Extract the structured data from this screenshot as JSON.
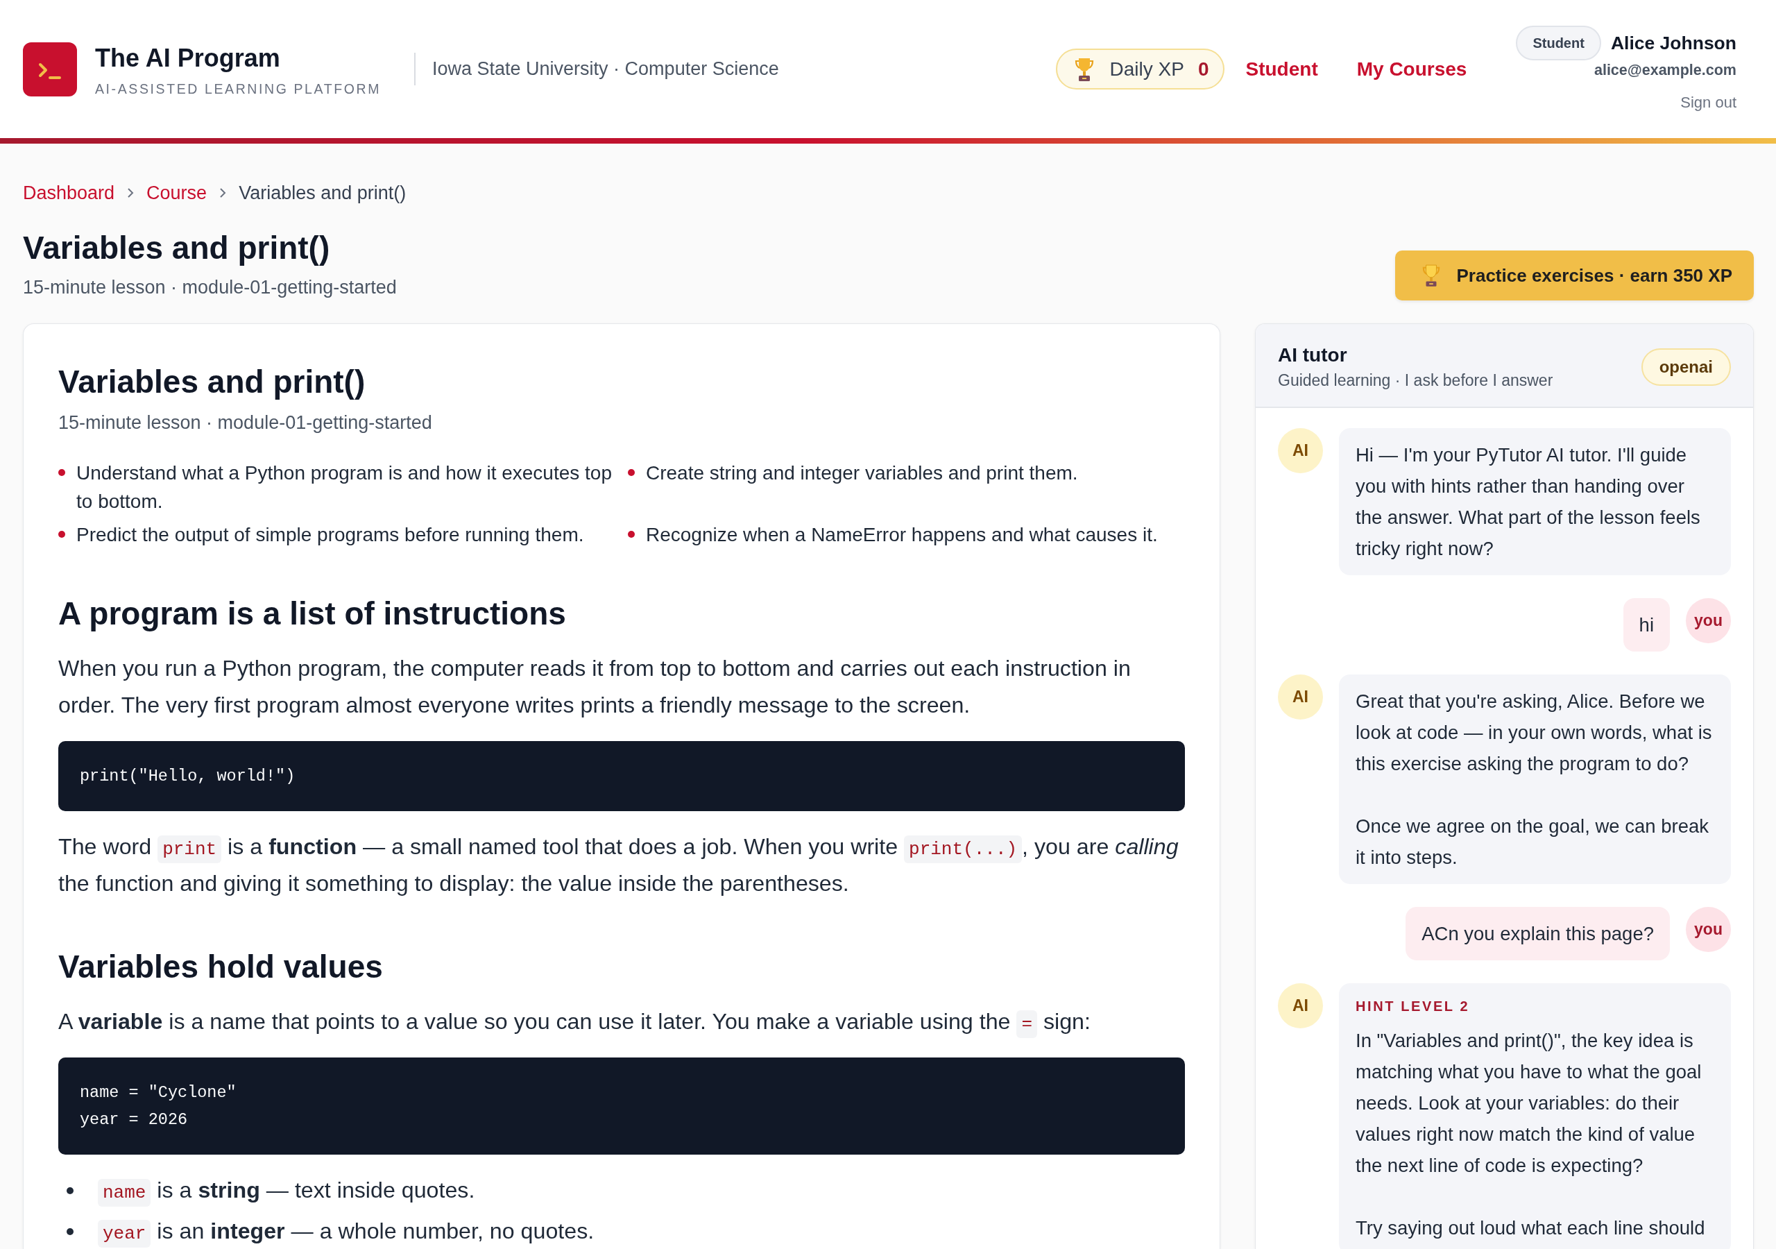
{
  "header": {
    "brand": {
      "title": "The AI Program",
      "tagline": "AI-ASSISTED LEARNING PLATFORM"
    },
    "institution": "Iowa State University · Computer Science",
    "daily_xp": {
      "label": "Daily XP",
      "value": "0"
    },
    "nav": [
      {
        "label": "Student"
      },
      {
        "label": "My Courses"
      }
    ],
    "user": {
      "role": "Student",
      "name": "Alice Johnson",
      "email": "alice@example.com",
      "sign_out": "Sign out"
    }
  },
  "breadcrumb": [
    {
      "label": "Dashboard",
      "kind": "link"
    },
    {
      "label": "Course",
      "kind": "link"
    },
    {
      "label": "Variables and print()",
      "kind": "current"
    }
  ],
  "page_header": {
    "title": "Variables and print()",
    "meta": "15-minute lesson · module-01-getting-started",
    "practice_button": "Practice exercises · earn 350 XP"
  },
  "lesson": {
    "title": "Variables and print()",
    "meta": "15-minute lesson · module-01-getting-started",
    "objectives": [
      "Understand what a Python program is and how it executes top to bottom.",
      "Create string and integer variables and print them.",
      "Predict the output of simple programs before running them.",
      "Recognize when a NameError happens and what causes it."
    ],
    "blocks": [
      {
        "kind": "heading",
        "text": "A program is a list of instructions"
      },
      {
        "kind": "paragraph",
        "parts": [
          {
            "kind": "text",
            "text": "When you run a Python program, the computer reads it from top to bottom and carries out each instruction in order. The very first program almost everyone writes prints a friendly message to the screen."
          }
        ]
      },
      {
        "kind": "code",
        "lines": [
          "print(\"Hello, world!\")"
        ]
      },
      {
        "kind": "paragraph",
        "parts": [
          {
            "kind": "text",
            "text": "The word "
          },
          {
            "kind": "code",
            "text": "print"
          },
          {
            "kind": "text",
            "text": " is a **function** — a small named tool that does a job. When you write "
          },
          {
            "kind": "code",
            "text": "print(...)"
          },
          {
            "kind": "text",
            "text": ", you are *calling* the function and giving it something to display: the value inside the parentheses."
          }
        ]
      },
      {
        "kind": "heading",
        "text": "Variables hold values"
      },
      {
        "kind": "paragraph",
        "parts": [
          {
            "kind": "text",
            "text": "A **variable** is a name that points to a value so you can use it later. You make a variable using the "
          },
          {
            "kind": "code",
            "text": "="
          },
          {
            "kind": "text",
            "text": " sign:"
          }
        ]
      },
      {
        "kind": "code",
        "lines": [
          "name = \"Cyclone\"",
          "year = 2026"
        ]
      },
      {
        "kind": "list",
        "items": [
          {
            "parts": [
              {
                "kind": "code",
                "text": "name"
              },
              {
                "kind": "text",
                "text": " is a **string** — text inside quotes."
              }
            ]
          },
          {
            "parts": [
              {
                "kind": "code",
                "text": "year"
              },
              {
                "kind": "text",
                "text": " is an **integer** — a whole number, no quotes."
              }
            ]
          }
        ]
      }
    ]
  },
  "tutor": {
    "title": "AI tutor",
    "subtitle": "Guided learning · I ask before I answer",
    "provider": "openai",
    "messages": [
      {
        "kind": "ai",
        "avatar": "AI",
        "paragraphs": [
          "Hi — I'm your PyTutor AI tutor. I'll guide you with hints rather than handing over the answer. What part of the lesson feels tricky right now?"
        ]
      },
      {
        "kind": "user",
        "avatar": "you",
        "paragraphs": [
          "hi"
        ]
      },
      {
        "kind": "ai",
        "avatar": "AI",
        "paragraphs": [
          "Great that you're asking, Alice. Before we look at code — in your own words, what is this exercise asking the program to do?",
          "Once we agree on the goal, we can break it into steps."
        ]
      },
      {
        "kind": "user",
        "avatar": "you",
        "paragraphs": [
          "ACn you explain this page?"
        ]
      },
      {
        "kind": "ai",
        "avatar": "AI",
        "label": "HINT LEVEL 2",
        "paragraphs": [
          "In \"Variables and print()\", the key idea is matching what you have to what the goal needs. Look at your variables: do their values right now match the kind of value the next line of code is expecting?",
          "Try saying out loud what each line should"
        ]
      }
    ]
  }
}
